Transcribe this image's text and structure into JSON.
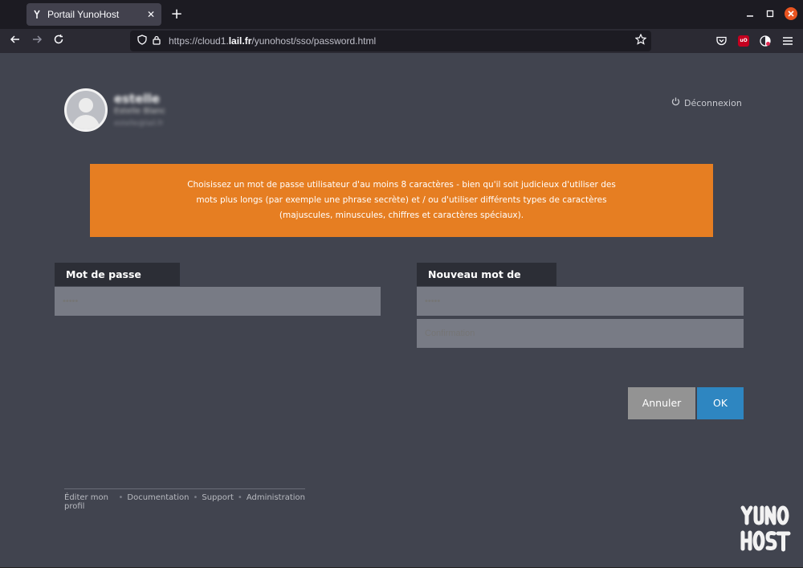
{
  "browser": {
    "tab_title": "Portail YunoHost",
    "tab_close": "✕",
    "new_tab": "+",
    "url_prefix": "https://cloud1.",
    "url_domain": "lail.fr",
    "url_path": "/yunohost/sso/password.html",
    "ublock_badge": "uO"
  },
  "user": {
    "username": "estelle",
    "full_name": "Estelle Blanc",
    "email": "estelle@lail.fr"
  },
  "header": {
    "logout_label": "Déconnexion"
  },
  "alert": {
    "text": "Choisissez un mot de passe utilisateur d'au moins 8 caractères - bien qu'il soit judicieux d'utiliser des mots plus longs (par exemple une phrase secrète) et / ou d'utiliser différents types de caractères (majuscules, minuscules, chiffres et caractères spéciaux)."
  },
  "form": {
    "current_label": "Mot de passe actuel",
    "current_placeholder": "•••••",
    "new_label": "Nouveau mot de passe",
    "new_placeholder": "•••••",
    "confirm_placeholder": "Confirmation",
    "cancel_label": "Annuler",
    "ok_label": "OK"
  },
  "footer": {
    "links": [
      "Éditer mon profil",
      "Documentation",
      "Support",
      "Administration"
    ],
    "separator": "•"
  },
  "colors": {
    "alert": "#e67e22",
    "ok_button": "#2e86c1",
    "cancel_button": "#939393",
    "page_background": "#41444f"
  }
}
